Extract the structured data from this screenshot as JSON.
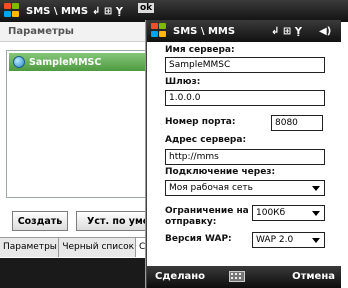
{
  "back": {
    "title": "SMS \\ MMS",
    "ok": "ok",
    "header": "Параметры",
    "list_item": "SampleMMSC",
    "create_button": "Создать",
    "default_button": "Уст. по умолч",
    "tabs": [
      "Параметры",
      "Черный список",
      "Сер"
    ]
  },
  "front": {
    "title": "SMS \\ MMS",
    "server_name_label": "Имя сервера:",
    "server_name_value": "SampleMMSC",
    "gateway_label": "Шлюз:",
    "gateway_value": "1.0.0.0",
    "port_label": "Номер порта:",
    "port_value": "8080",
    "server_addr_label": "Адрес сервера:",
    "server_addr_value": "http://mms",
    "connect_label": "Подключение через:",
    "connect_value": "Моя рабочая сеть",
    "limit_label_1": "Ограничение на",
    "limit_label_2": "отправку:",
    "limit_value": "100Кб",
    "wap_label": "Версия WAP:",
    "wap_value": "WAP 2.0",
    "done": "Сделано",
    "cancel": "Отмена"
  },
  "colors": {
    "selection_green": "#5fae4f",
    "titlebar": "#1a1a1a"
  },
  "icons": [
    "windows-logo-icon",
    "signal-icon",
    "speaker-icon",
    "keyboard-icon",
    "globe-icon"
  ]
}
